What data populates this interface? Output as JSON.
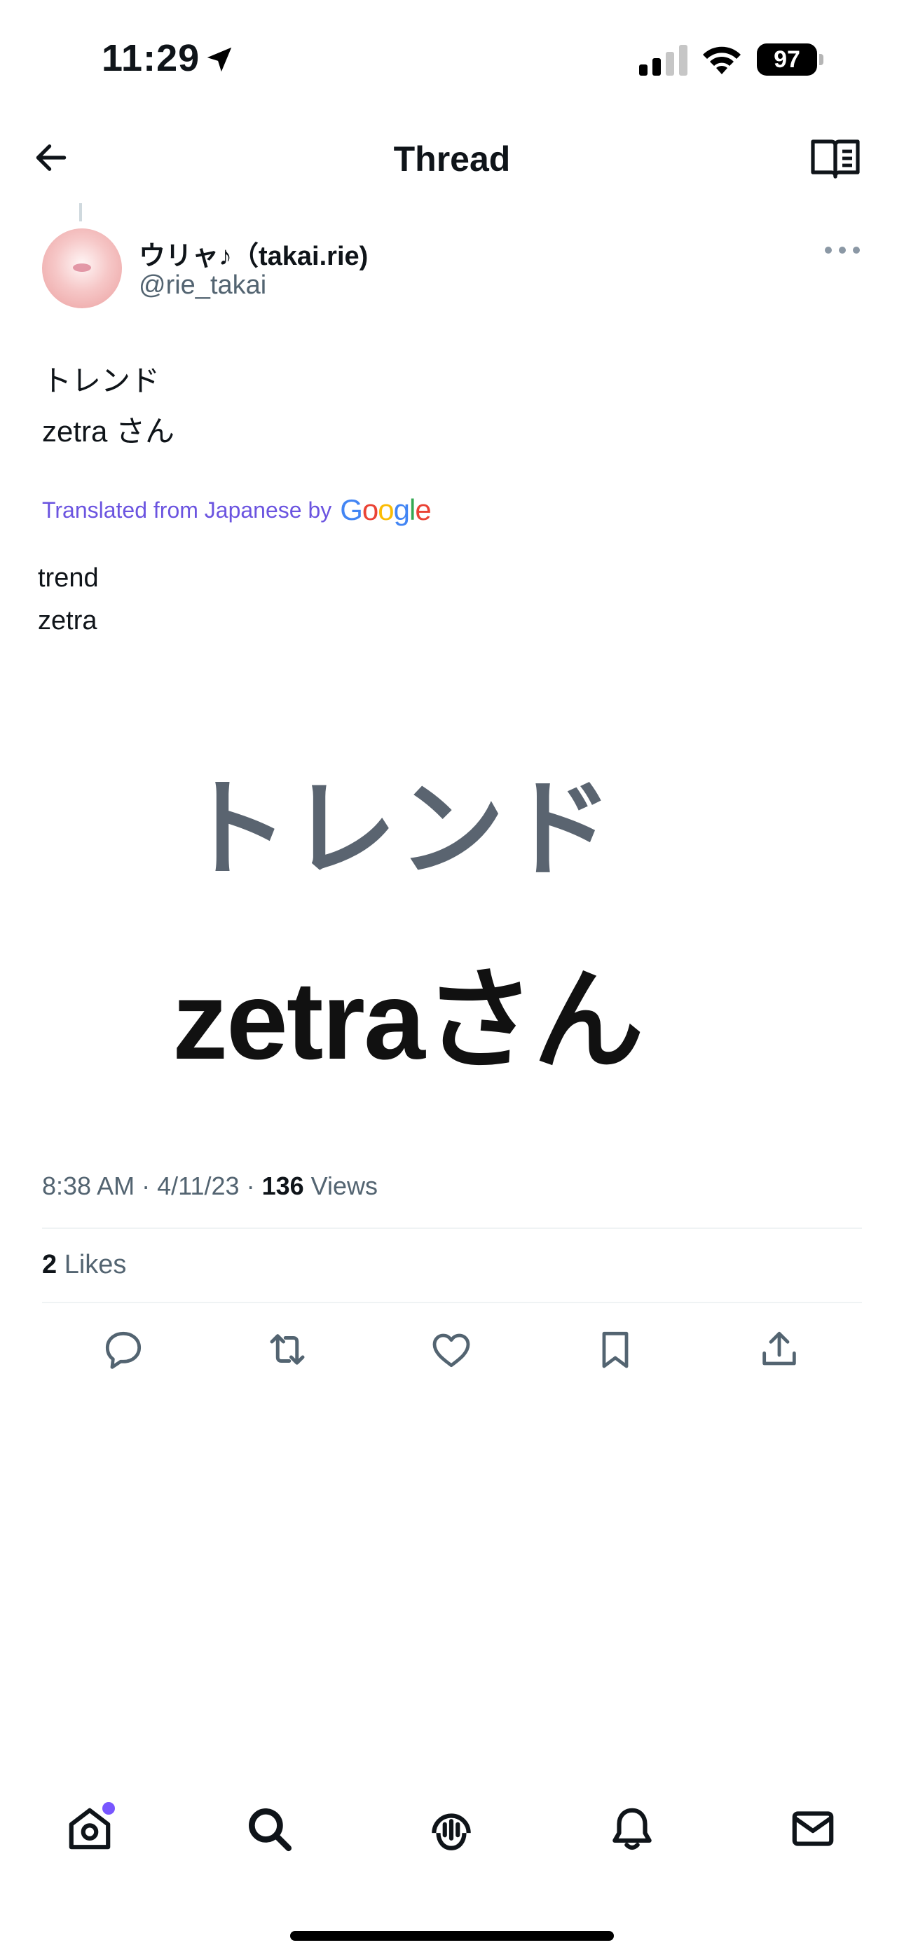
{
  "status_bar": {
    "time": "11:29",
    "battery": "97",
    "icons": [
      "location-arrow-icon",
      "signal-icon",
      "wifi-icon",
      "battery-icon"
    ]
  },
  "header": {
    "title": "Thread",
    "back_icon": "back-arrow-icon",
    "reader_icon": "reader-mode-icon"
  },
  "tweet": {
    "display_name": "ウリャ♪（takai.rie)",
    "handle": "@rie_takai",
    "text_lines": [
      "トレンド",
      "zetra さん"
    ],
    "translated_label": "Translated from Japanese by",
    "translator": "Google",
    "translation_lines": [
      "trend",
      "zetra"
    ],
    "media": {
      "line1": "トレンド",
      "line2": "zetraさん"
    },
    "time": "8:38 AM",
    "date": "4/11/23",
    "views_count": "136",
    "views_label": "Views",
    "likes_count": "2",
    "likes_label": "Likes"
  },
  "actions": [
    "reply-icon",
    "retweet-icon",
    "like-icon",
    "bookmark-icon",
    "share-icon"
  ],
  "bottom_nav": [
    "home-icon",
    "search-icon",
    "spaces-icon",
    "notifications-icon",
    "messages-icon"
  ],
  "colors": {
    "accent": "#7856ff",
    "translated": "#6b54e0",
    "secondary_text": "#536471",
    "primary_text": "#0f1419"
  }
}
